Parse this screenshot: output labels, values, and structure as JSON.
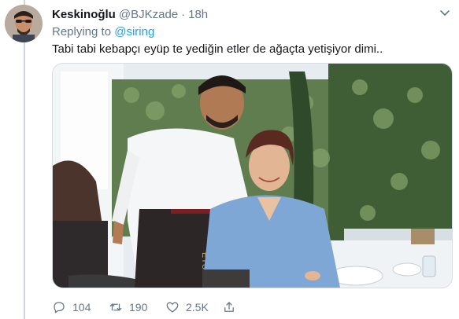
{
  "tweet": {
    "display_name": "Keskinoğlu",
    "handle": "@BJKzade",
    "separator": "·",
    "time": "18h",
    "replying_prefix": "Replying to",
    "replying_to": "@siring",
    "text": "Tabi tabi kebapçı eyüp te yediğin etler de ağaçta yetişiyor dimi..",
    "apron_text": "EYÜP"
  },
  "actions": {
    "reply_count": "104",
    "retweet_count": "190",
    "like_count": "2.5K"
  },
  "icons": {
    "menu": "chevron-down-icon",
    "reply": "reply-icon",
    "retweet": "retweet-icon",
    "like": "heart-icon",
    "share": "share-icon"
  },
  "colors": {
    "link": "#1da1f2",
    "secondary_text": "#657786",
    "primary_text": "#14171a",
    "thread_line": "#ccd6dd"
  }
}
